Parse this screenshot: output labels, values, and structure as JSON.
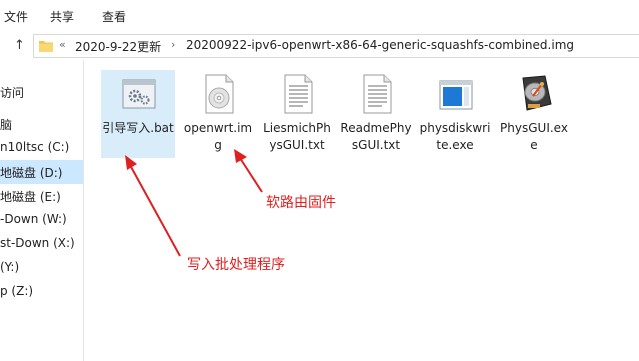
{
  "ribbon": {
    "tabs": [
      "文件",
      "共享",
      "查看"
    ]
  },
  "nav": {
    "up_arrow": "↑"
  },
  "address": {
    "overflow": "«",
    "crumbs": [
      "2020-9-22更新",
      "20200922-ipv6-openwrt-x86-64-generic-squashfs-combined.img"
    ],
    "separator": "›"
  },
  "sidebar": {
    "items": [
      {
        "label": "访问",
        "selected": false
      },
      {
        "label": "脑",
        "selected": false
      },
      {
        "label": "n10ltsc (C:)",
        "selected": false
      },
      {
        "label": "地磁盘 (D:)",
        "selected": true
      },
      {
        "label": "地磁盘 (E:)",
        "selected": false
      },
      {
        "label": "-Down (W:)",
        "selected": false
      },
      {
        "label": "st-Down (X:)",
        "selected": false
      },
      {
        "label": "(Y:)",
        "selected": false
      },
      {
        "label": "p (Z:)",
        "selected": false
      }
    ]
  },
  "files": [
    {
      "name": "引导写入.bat",
      "icon": "batch-file-icon",
      "selected": true
    },
    {
      "name": "openwrt.img",
      "icon": "disc-image-icon",
      "selected": false
    },
    {
      "name": "LiesmichPhysGUI.txt",
      "icon": "text-file-icon",
      "selected": false
    },
    {
      "name": "ReadmePhysGUI.txt",
      "icon": "text-file-icon",
      "selected": false
    },
    {
      "name": "physdiskwrite.exe",
      "icon": "exe-window-icon",
      "selected": false
    },
    {
      "name": "PhysGUI.exe",
      "icon": "hard-drive-icon",
      "selected": false
    }
  ],
  "annotations": {
    "firmware": "软路由固件",
    "batch": "写入批处理程序"
  },
  "colors": {
    "accent": "#e02020",
    "selection": "#cce8ff"
  }
}
